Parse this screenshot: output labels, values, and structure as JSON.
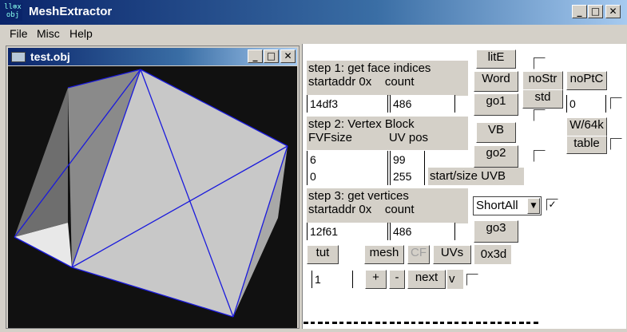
{
  "app": {
    "title": "MeshExtractor",
    "icon_text": "ll⊗x obj",
    "icon_name": "meshextractor-icon"
  },
  "window_controls": {
    "minimize": "_",
    "maximize": "□",
    "close": "✕"
  },
  "menu": [
    "File",
    "Misc",
    "Help"
  ],
  "child_window": {
    "title": "test.obj"
  },
  "step1": {
    "title": "step 1: get face indices",
    "sub": "startaddr 0x    count",
    "startaddr": "14df3",
    "count": "486"
  },
  "step2": {
    "title": "step 2: Vertex Block",
    "sub": "FVFsize           UV pos",
    "fvfsize": "6",
    "uvpos": "99",
    "start": "0",
    "size": "255",
    "uvb_label": "start/size UVB"
  },
  "step3": {
    "title": "step 3: get vertices",
    "sub": "startaddr 0x    count",
    "startaddr": "12f61",
    "count": "486",
    "combo_value": "ShortAll",
    "combo_checked": "✓"
  },
  "buttons": {
    "lite": "litE",
    "word": "Word",
    "go1": "go1",
    "nostr": "noStr",
    "std": "std",
    "noptc": "noPtC",
    "noptc_value": "0",
    "vb": "VB",
    "w64k": "W/64k",
    "table": "table",
    "go2": "go2",
    "go3": "go3",
    "tut": "tut",
    "mesh": "mesh",
    "cf": "CF",
    "uvs": "UVs",
    "hex": "0x3d",
    "plus": "+",
    "minus": "-",
    "next": "next",
    "v": "v"
  },
  "nav": {
    "value": "1"
  },
  "partial_text": "(obscured text at bottom)",
  "colors": {
    "panel_bg": "#d4d0c8",
    "title_blue": "#0a246a",
    "mesh_edge": "#1a1adc",
    "viewport_bg": "#111111"
  }
}
